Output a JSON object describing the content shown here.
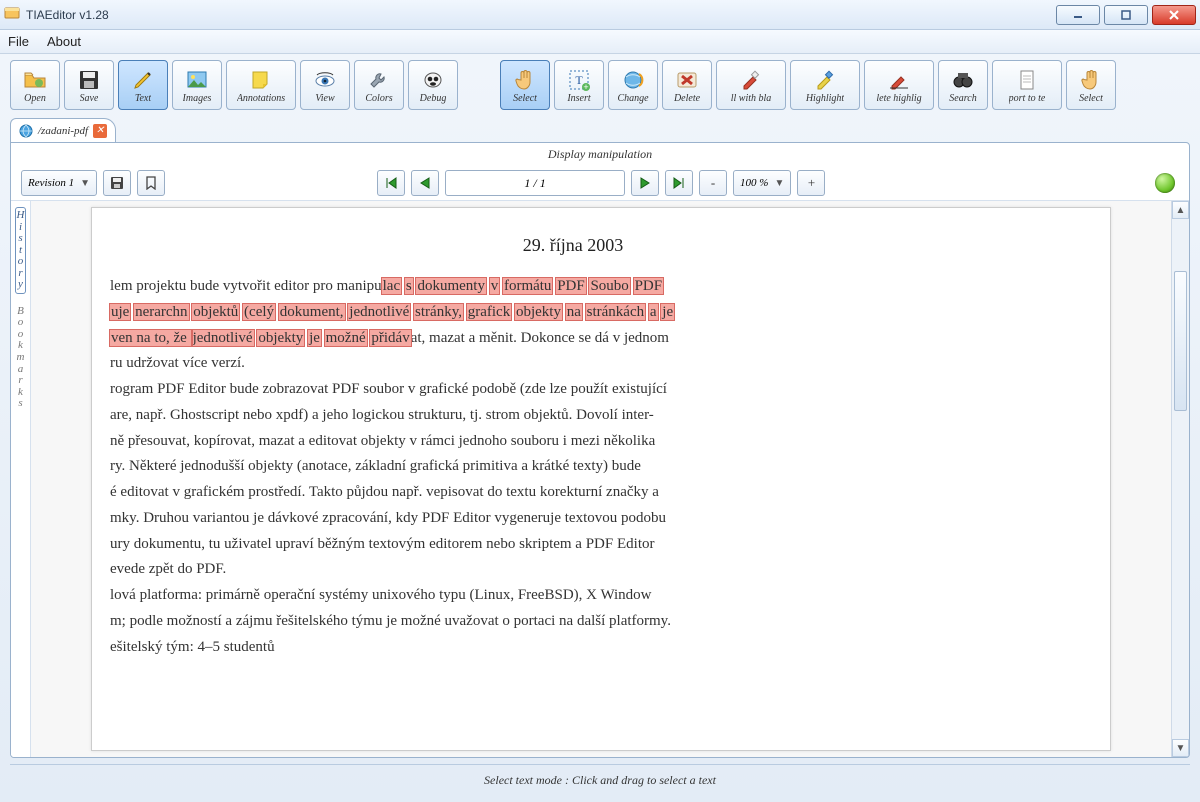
{
  "window": {
    "title": "TIAEditor v1.28"
  },
  "menu": {
    "file": "File",
    "about": "About"
  },
  "toolbar_left": [
    {
      "id": "open",
      "label": "Open",
      "icon": "folder-open-icon"
    },
    {
      "id": "save",
      "label": "Save",
      "icon": "floppy-icon"
    },
    {
      "id": "text",
      "label": "Text",
      "icon": "pencil-icon",
      "active": true
    },
    {
      "id": "images",
      "label": "Images",
      "icon": "picture-icon"
    },
    {
      "id": "annotations",
      "label": "Annotations",
      "icon": "sticky-note-icon",
      "wide": true
    },
    {
      "id": "view",
      "label": "View",
      "icon": "eye-icon"
    },
    {
      "id": "colors",
      "label": "Colors",
      "icon": "wrench-icon"
    },
    {
      "id": "debug",
      "label": "Debug",
      "icon": "mask-icon"
    }
  ],
  "toolbar_right": [
    {
      "id": "select",
      "label": "Select",
      "icon": "hand-icon",
      "active": true
    },
    {
      "id": "insert",
      "label": "Insert",
      "icon": "text-frame-icon"
    },
    {
      "id": "change",
      "label": "Change",
      "icon": "globe-refresh-icon"
    },
    {
      "id": "delete",
      "label": "Delete",
      "icon": "delete-x-icon"
    },
    {
      "id": "fillblack",
      "label": "ll with bla",
      "icon": "marker-red-icon",
      "wide": true
    },
    {
      "id": "highlight",
      "label": "Highlight",
      "icon": "marker-blue-icon",
      "wide": true
    },
    {
      "id": "delhighlig",
      "label": "lete highlig",
      "icon": "marker-clear-icon",
      "wide": true
    },
    {
      "id": "search",
      "label": "Search",
      "icon": "binoculars-icon"
    },
    {
      "id": "export",
      "label": "port to te",
      "icon": "page-icon",
      "wide": true
    },
    {
      "id": "select2",
      "label": "Select",
      "icon": "hand-icon"
    }
  ],
  "tab": {
    "label": "/zadani-pdf"
  },
  "panel": {
    "title": "Display manipulation"
  },
  "nav": {
    "revision": "Revision 1",
    "page": "1 / 1",
    "zoom": "100 %",
    "minus": "-",
    "plus": "+"
  },
  "side": {
    "history": [
      "H",
      "i",
      "s",
      "t",
      "o",
      "r",
      "y"
    ],
    "bookmarks": [
      "B",
      "o",
      "o",
      "k",
      "m",
      "a",
      "r",
      "k",
      "s"
    ]
  },
  "document": {
    "date": "29. října 2003",
    "p1a": "lem projektu bude vytvořit editor pro manipu",
    "p1h": [
      "lac",
      "s",
      "dokumenty",
      "v",
      "formátu",
      "PDF",
      "Soubo",
      "PDF"
    ],
    "p2h": [
      "uje",
      "nerarchn",
      "objektů",
      "(celý",
      "dokument,",
      "jednotlivé",
      "stránky,",
      "grafick",
      "objekty",
      "na",
      "stránkách",
      "a",
      "je"
    ],
    "p3a": "ven na to, že ",
    "p3h": [
      "jednotlivé",
      "objekty",
      "je",
      "možné",
      "přidáv"
    ],
    "p3b": "at, mazat a měnit. Dokonce se dá v jednom",
    "p4": "ru udržovat více verzí.",
    "p5": "rogram PDF Editor bude zobrazovat PDF soubor v grafické podobě (zde lze použít existující",
    "p6": "are, např. Ghostscript nebo xpdf) a jeho logickou strukturu, tj. strom objektů. Dovolí inter-",
    "p7": "ně přesouvat, kopírovat, mazat a editovat objekty v rámci jednoho souboru i mezi několika",
    "p8": "ry. Některé jednodušší objekty (anotace, základní grafická primitiva a krátké texty) bude",
    "p9": "é editovat v grafickém prostředí. Takto půjdou např. vepisovat do textu korekturní značky a",
    "p10": "mky. Druhou variantou je dávkové zpracování, kdy PDF Editor vygeneruje textovou podobu",
    "p11": "ury dokumentu, tu uživatel upraví běžným textovým editorem nebo skriptem a PDF Editor",
    "p12": "evede zpět do PDF.",
    "p13": "lová platforma: primárně operační systémy unixového typu (Linux, FreeBSD), X Window",
    "p14": "m; podle možností a zájmu řešitelského týmu je možné uvažovat o portaci na další platformy.",
    "p15": "ešitelský tým: 4–5 studentů"
  },
  "status": "Select text mode : Click and drag to select a text"
}
